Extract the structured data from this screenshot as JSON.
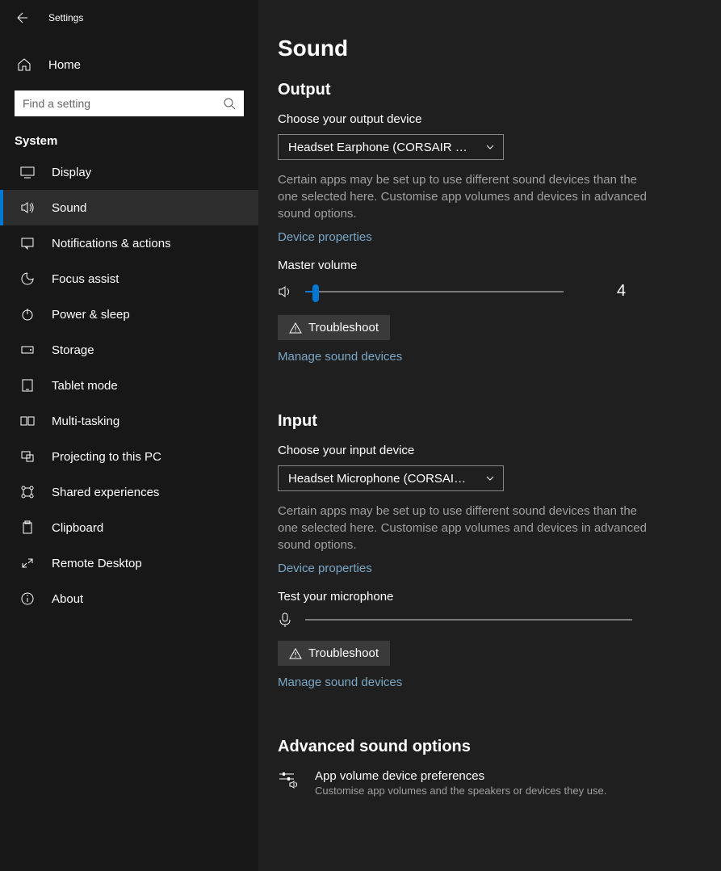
{
  "app_title": "Settings",
  "home_label": "Home",
  "search_placeholder": "Find a setting",
  "section_label": "System",
  "nav": [
    {
      "label": "Display"
    },
    {
      "label": "Sound"
    },
    {
      "label": "Notifications & actions"
    },
    {
      "label": "Focus assist"
    },
    {
      "label": "Power & sleep"
    },
    {
      "label": "Storage"
    },
    {
      "label": "Tablet mode"
    },
    {
      "label": "Multi-tasking"
    },
    {
      "label": "Projecting to this PC"
    },
    {
      "label": "Shared experiences"
    },
    {
      "label": "Clipboard"
    },
    {
      "label": "Remote Desktop"
    },
    {
      "label": "About"
    }
  ],
  "page_title": "Sound",
  "output": {
    "heading": "Output",
    "choose_label": "Choose your output device",
    "device": "Headset Earphone (CORSAIR VOI...",
    "help": "Certain apps may be set up to use different sound devices than the one selected here. Customise app volumes and devices in advanced sound options.",
    "props_link": "Device properties",
    "master_label": "Master volume",
    "volume": 4,
    "troubleshoot": "Troubleshoot",
    "manage_link": "Manage sound devices"
  },
  "input": {
    "heading": "Input",
    "choose_label": "Choose your input device",
    "device": "Headset Microphone (CORSAIR V...",
    "help": "Certain apps may be set up to use different sound devices than the one selected here. Customise app volumes and devices in advanced sound options.",
    "props_link": "Device properties",
    "test_label": "Test your microphone",
    "troubleshoot": "Troubleshoot",
    "manage_link": "Manage sound devices"
  },
  "advanced": {
    "heading": "Advanced sound options",
    "item_title": "App volume  device preferences",
    "item_sub": "Customise app volumes and the speakers or devices they use."
  }
}
